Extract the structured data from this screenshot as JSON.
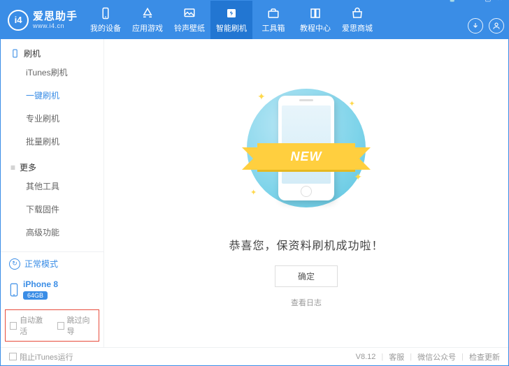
{
  "brand": {
    "title": "爱思助手",
    "url": "www.i4.cn",
    "logo_mark": "i4"
  },
  "navs": [
    {
      "label": "我的设备"
    },
    {
      "label": "应用游戏"
    },
    {
      "label": "铃声壁纸"
    },
    {
      "label": "智能刷机"
    },
    {
      "label": "工具箱"
    },
    {
      "label": "教程中心"
    },
    {
      "label": "爱思商城"
    }
  ],
  "sidebar": {
    "group_flash": "刷机",
    "items_flash": [
      {
        "label": "iTunes刷机"
      },
      {
        "label": "一键刷机"
      },
      {
        "label": "专业刷机"
      },
      {
        "label": "批量刷机"
      }
    ],
    "group_more": "更多",
    "items_more": [
      {
        "label": "其他工具"
      },
      {
        "label": "下载固件"
      },
      {
        "label": "高级功能"
      }
    ],
    "mode": "正常模式",
    "device_name": "iPhone 8",
    "device_storage": "64GB",
    "cb_auto_activate": "自动激活",
    "cb_skip_wizard": "跳过向导"
  },
  "main": {
    "ribbon": "NEW",
    "message": "恭喜您，保资料刷机成功啦！",
    "ok": "确定",
    "view_log": "查看日志"
  },
  "status": {
    "block_itunes": "阻止iTunes运行",
    "version": "V8.12",
    "support": "客服",
    "wechat": "微信公众号",
    "check_update": "检查更新"
  }
}
